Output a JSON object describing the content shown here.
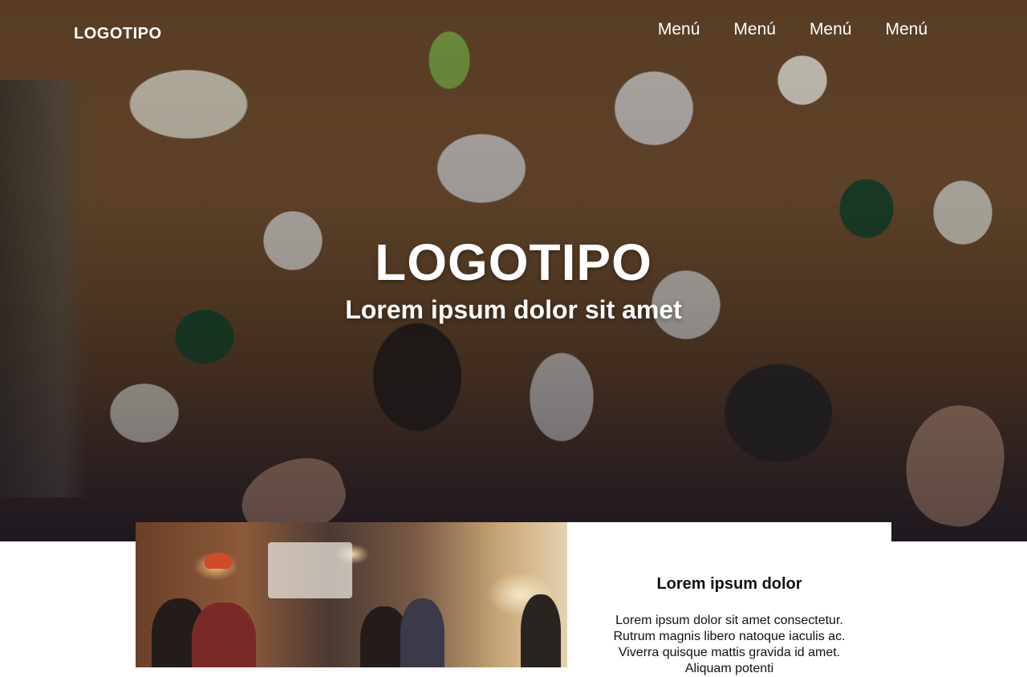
{
  "nav": {
    "logo": "LOGOTIPO",
    "menu": [
      "Menú",
      "Menú",
      "Menú",
      "Menú"
    ]
  },
  "hero": {
    "title": "LOGOTIPO",
    "subtitle": "Lorem ipsum dolor sit amet"
  },
  "card": {
    "title": "Lorem ipsum dolor",
    "lines": [
      "Lorem ipsum dolor sit amet consectetur.",
      "Rutrum magnis libero natoque iaculis ac.",
      "Viverra quisque mattis gravida id amet.",
      "Aliquam potenti"
    ]
  },
  "colors": {
    "text_light": "#ffffff",
    "text_dark": "#111111",
    "background": "#ffffff"
  },
  "icons": {
    "hero_image": "food-table-photo",
    "section_image": "restaurant-interior-photo"
  }
}
